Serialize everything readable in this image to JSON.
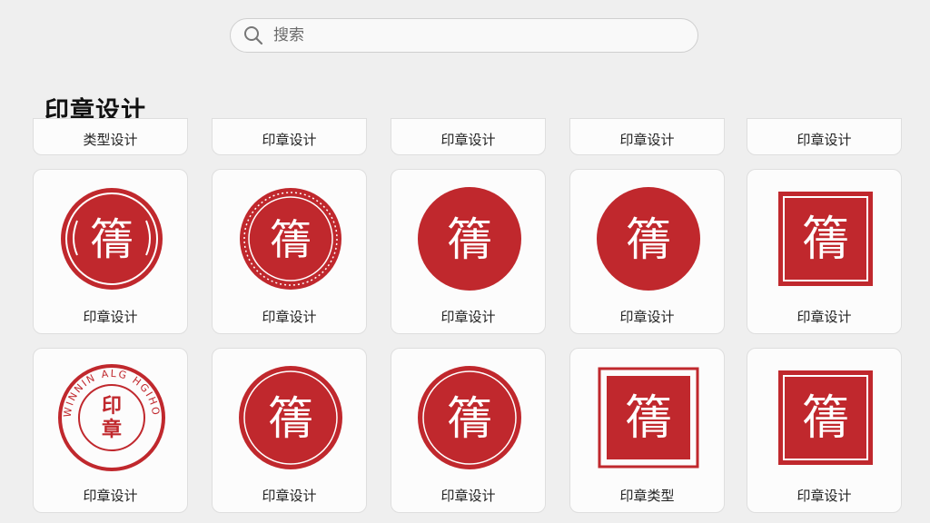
{
  "search": {
    "placeholder": "搜索"
  },
  "section": {
    "title": "印章设计"
  },
  "top_row": [
    "类型设计",
    "印章设计",
    "印章设计",
    "印章设计",
    "印章设计"
  ],
  "grid": [
    [
      {
        "label": "印章设计",
        "seal_char": "篟"
      },
      {
        "label": "印章设计",
        "seal_char": "篟"
      },
      {
        "label": "印章设计",
        "seal_char": "篟"
      },
      {
        "label": "印章设计",
        "seal_char": "篟"
      },
      {
        "label": "印章设计",
        "seal_char": "篟"
      }
    ],
    [
      {
        "label": "印章设计",
        "seal_char": "印章",
        "ring_text": "WINNIN ALG HGIHO"
      },
      {
        "label": "印章设计",
        "seal_char": "篟"
      },
      {
        "label": "印章设计",
        "seal_char": "篟"
      },
      {
        "label": "印章类型",
        "seal_char": "篟"
      },
      {
        "label": "印章设计",
        "seal_char": "篟"
      }
    ]
  ],
  "colors": {
    "seal_red": "#c0282d",
    "background": "#efefef",
    "card": "#fcfcfc"
  }
}
